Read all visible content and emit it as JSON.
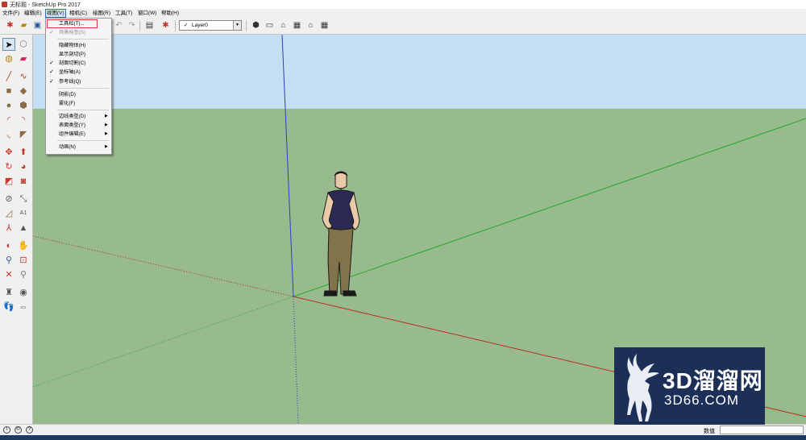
{
  "window": {
    "title": "无标题 - SketchUp Pro 2017"
  },
  "menubar": {
    "items": [
      {
        "label": "文件(F)"
      },
      {
        "label": "编辑(E)"
      },
      {
        "label": "视图(V)"
      },
      {
        "label": "相机(C)"
      },
      {
        "label": "绘图(R)"
      },
      {
        "label": "工具(T)"
      },
      {
        "label": "窗口(W)"
      },
      {
        "label": "帮助(H)"
      }
    ]
  },
  "toolbar": {
    "layer": {
      "value": "Layer0",
      "check": "✓"
    }
  },
  "view_menu": {
    "items": [
      {
        "label": "工具栏(T)...",
        "checked": false,
        "disabled": false,
        "submenu": false
      },
      {
        "label": "场景标签(S)",
        "checked": true,
        "disabled": true,
        "submenu": false
      },
      {
        "label": "隐藏物体(H)",
        "checked": false,
        "disabled": false,
        "submenu": false
      },
      {
        "label": "显示剖切(P)",
        "checked": false,
        "disabled": false,
        "submenu": false
      },
      {
        "label": "剖面切割(C)",
        "checked": true,
        "disabled": false,
        "submenu": false
      },
      {
        "label": "坐标轴(A)",
        "checked": true,
        "disabled": false,
        "submenu": false
      },
      {
        "label": "参考线(Q)",
        "checked": true,
        "disabled": false,
        "submenu": false
      },
      {
        "label": "阴影(D)",
        "checked": false,
        "disabled": false,
        "submenu": false
      },
      {
        "label": "雾化(F)",
        "checked": false,
        "disabled": false,
        "submenu": false
      },
      {
        "label": "边线类型(D)",
        "checked": false,
        "disabled": false,
        "submenu": true
      },
      {
        "label": "表面类型(Y)",
        "checked": false,
        "disabled": false,
        "submenu": true
      },
      {
        "label": "组件编辑(E)",
        "checked": false,
        "disabled": false,
        "submenu": true
      },
      {
        "label": "动画(N)",
        "checked": false,
        "disabled": false,
        "submenu": true
      }
    ]
  },
  "statusbar": {
    "measure_label": "数值",
    "measure_value": ""
  },
  "watermark": {
    "line1": "3D溜溜网",
    "line2": "3D66.COM"
  },
  "colors": {
    "sky": "#c6def1",
    "ground": "#98bb8e",
    "axis_red": "#b52e1e",
    "axis_green": "#27a52a",
    "axis_blue": "#2b3ec2",
    "menu_highlight": "#d9383f",
    "watermark_bg": "#1c2f57"
  }
}
